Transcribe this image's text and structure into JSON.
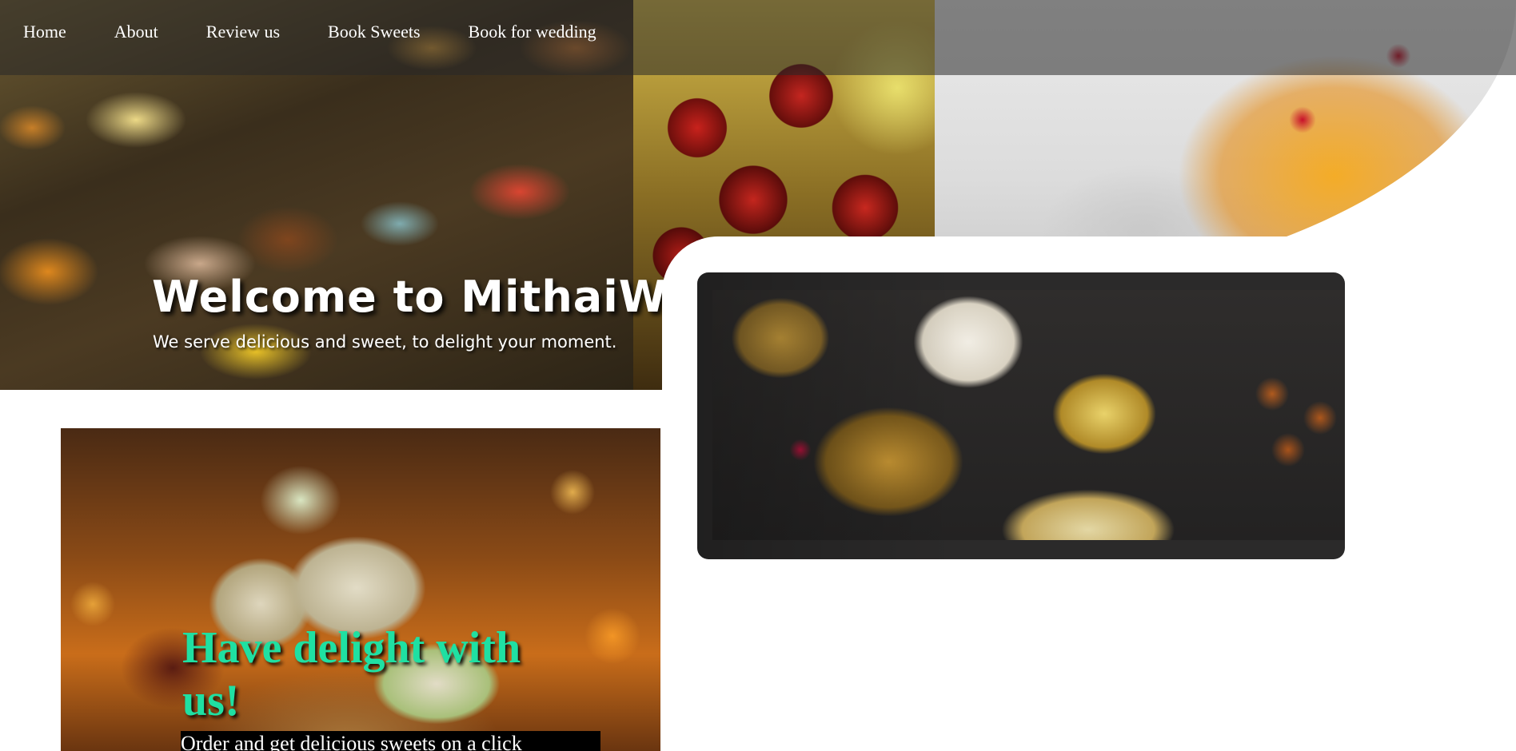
{
  "nav": {
    "items": [
      {
        "label": "Home"
      },
      {
        "label": "About"
      },
      {
        "label": "Review us"
      },
      {
        "label": "Book Sweets"
      },
      {
        "label": "Book for wedding"
      }
    ]
  },
  "hero": {
    "title": "Welcome to MithaiWala",
    "subtitle": "We serve delicious and sweet, to delight your moment."
  },
  "promo": {
    "heading": "Have delight with us!",
    "text": "Order and get delicious sweets on a click"
  },
  "colors": {
    "nav_overlay": "#282828",
    "promo_heading": "#1fe0a2",
    "promo_text_bg": "#000000",
    "text_white": "#ffffff"
  }
}
